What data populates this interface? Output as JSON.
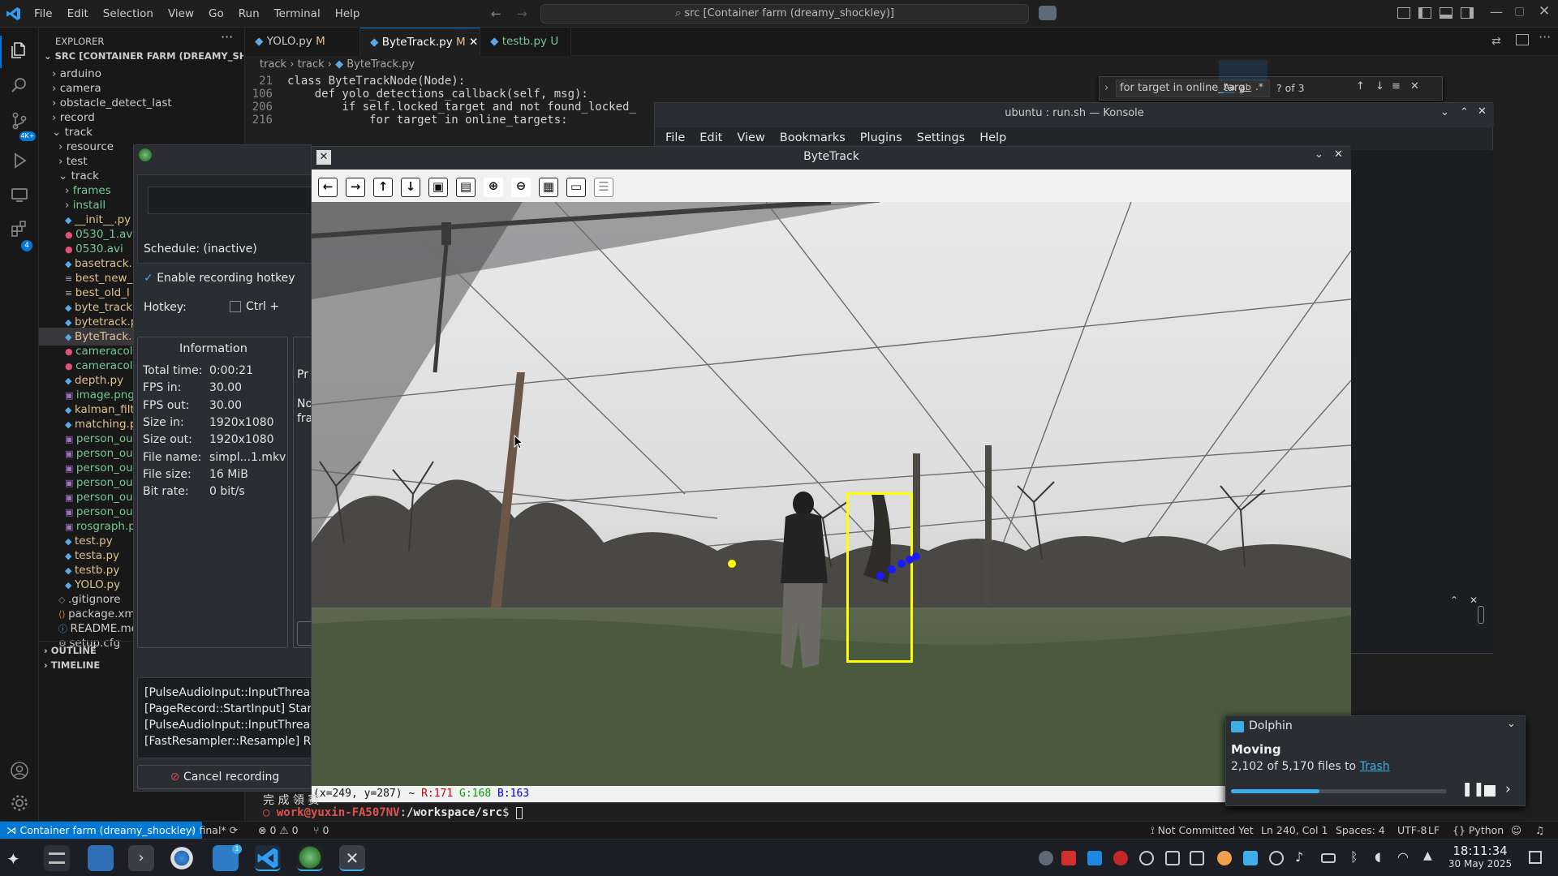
{
  "menubar": [
    "File",
    "Edit",
    "Selection",
    "View",
    "Go",
    "Run",
    "Terminal",
    "Help"
  ],
  "command_center": "src [Container farm (dreamy_shockley)]",
  "explorer": {
    "title": "EXPLORER",
    "root": "SRC [CONTAINER FARM (DREAMY_SHOCK...",
    "items": [
      {
        "label": "arduino",
        "kind": "folder",
        "depth": 1,
        "open": false
      },
      {
        "label": "camera",
        "kind": "folder",
        "depth": 1,
        "open": false
      },
      {
        "label": "obstacle_detect_last",
        "kind": "folder",
        "depth": 1,
        "open": false
      },
      {
        "label": "record",
        "kind": "folder",
        "depth": 1,
        "open": false
      },
      {
        "label": "track",
        "kind": "folder",
        "depth": 1,
        "open": true
      },
      {
        "label": "resource",
        "kind": "folder",
        "depth": 2,
        "open": false
      },
      {
        "label": "test",
        "kind": "folder",
        "depth": 2,
        "open": false
      },
      {
        "label": "track",
        "kind": "folder",
        "depth": 2,
        "open": true
      },
      {
        "label": "frames",
        "kind": "folder",
        "depth": 3,
        "open": false
      },
      {
        "label": "install",
        "kind": "folder",
        "depth": 3,
        "open": false
      },
      {
        "label": "__init__.py",
        "kind": "py",
        "depth": 3
      },
      {
        "label": "0530_1.avi",
        "kind": "avi",
        "depth": 3
      },
      {
        "label": "0530.avi",
        "kind": "avi",
        "depth": 3
      },
      {
        "label": "basetrack.",
        "kind": "py",
        "depth": 3
      },
      {
        "label": "best_new_",
        "kind": "txt",
        "depth": 3
      },
      {
        "label": "best_old_l",
        "kind": "txt",
        "depth": 3
      },
      {
        "label": "byte_track",
        "kind": "py",
        "depth": 3
      },
      {
        "label": "bytetrack.p",
        "kind": "py",
        "depth": 3
      },
      {
        "label": "ByteTrack.",
        "kind": "py",
        "depth": 3,
        "selected": true
      },
      {
        "label": "cameracol",
        "kind": "avi",
        "depth": 3
      },
      {
        "label": "cameracol",
        "kind": "avi",
        "depth": 3
      },
      {
        "label": "depth.py",
        "kind": "py",
        "depth": 3
      },
      {
        "label": "image.png",
        "kind": "png",
        "depth": 3
      },
      {
        "label": "kalman_filt",
        "kind": "py",
        "depth": 3
      },
      {
        "label": "matching.p",
        "kind": "py",
        "depth": 3
      },
      {
        "label": "person_ou",
        "kind": "img",
        "depth": 3
      },
      {
        "label": "person_ou",
        "kind": "img",
        "depth": 3
      },
      {
        "label": "person_ou",
        "kind": "img",
        "depth": 3
      },
      {
        "label": "person_ou",
        "kind": "img",
        "depth": 3
      },
      {
        "label": "person_ou",
        "kind": "img",
        "depth": 3
      },
      {
        "label": "person_ou",
        "kind": "img",
        "depth": 3
      },
      {
        "label": "rosgraph.p",
        "kind": "img",
        "depth": 3
      },
      {
        "label": "test.py",
        "kind": "py",
        "depth": 3
      },
      {
        "label": "testa.py",
        "kind": "py",
        "depth": 3
      },
      {
        "label": "testb.py",
        "kind": "py",
        "depth": 3
      },
      {
        "label": "YOLO.py",
        "kind": "py",
        "depth": 3
      },
      {
        "label": ".gitignore",
        "kind": "git",
        "depth": 2
      },
      {
        "label": "package.xm",
        "kind": "xml",
        "depth": 2
      },
      {
        "label": "README.mc",
        "kind": "md",
        "depth": 2
      },
      {
        "label": "setup.cfg",
        "kind": "cfg",
        "depth": 2
      }
    ],
    "outline": "OUTLINE",
    "timeline": "TIMELINE"
  },
  "tabs": [
    {
      "label": "YOLO.py",
      "status": "M"
    },
    {
      "label": "ByteTrack.py",
      "status": "M"
    },
    {
      "label": "testb.py",
      "status": "U"
    }
  ],
  "breadcrumb": [
    "track",
    "track",
    "ByteTrack.py"
  ],
  "code": [
    {
      "line": "21",
      "text": "class ByteTrackNode(Node):"
    },
    {
      "line": "106",
      "text": "    def yolo_detections_callback(self, msg):"
    },
    {
      "line": "206",
      "text": "        if self.locked_target and not found_locked_"
    },
    {
      "line": "216",
      "text": "            for target in online_targets:"
    }
  ],
  "find_widget": {
    "query": "for target in online_targ",
    "count": "? of 3",
    "case": "Aa",
    "word": "ab",
    "regex": ".*"
  },
  "konsole": {
    "title": "ubuntu : run.sh — Konsole",
    "menu": [
      "File",
      "Edit",
      "View",
      "Bookmarks",
      "Plugins",
      "Settings",
      "Help"
    ],
    "partial_text": "完 成 領 赛",
    "prompt_user": "work@yuxin-FA507NV",
    "prompt_path": "/workspace/src",
    "prompt_symbol": "$"
  },
  "recorder": {
    "schedule": "Schedule: (inactive)",
    "enable_hotkey": "Enable recording hotkey",
    "hotkey_label": "Hotkey:",
    "hotkey_mod": "Ctrl +",
    "info_title": "Information",
    "info": [
      {
        "k": "Total time:",
        "v": "0:00:21"
      },
      {
        "k": "FPS in:",
        "v": "30.00"
      },
      {
        "k": "FPS out:",
        "v": "30.00"
      },
      {
        "k": "Size in:",
        "v": "1920x1080"
      },
      {
        "k": "Size out:",
        "v": "1920x1080"
      },
      {
        "k": "File name:",
        "v": "simpl...1.mkv"
      },
      {
        "k": "File size:",
        "v": "16 MiB"
      },
      {
        "k": "Bit rate:",
        "v": "0 bit/s"
      }
    ],
    "side_text_1": "Pr",
    "side_text_2": "No",
    "side_text_3": "fra",
    "log": [
      "[PulseAudioInput::InputThread",
      "[PageRecord::StartInput] Starte",
      "[PulseAudioInput::InputThread",
      "[FastResampler::Resample] Res"
    ],
    "cancel": "Cancel recording"
  },
  "bytetrack_window": {
    "title": "ByteTrack",
    "toolbar_icons": [
      "arrow-left-icon",
      "arrow-right-icon",
      "arrow-up-icon",
      "arrow-down-icon",
      "image-icon",
      "image-edit-icon",
      "zoom-in-icon",
      "zoom-out-icon",
      "save-icon",
      "clipboard-icon",
      "properties-icon"
    ],
    "status_coords": "(x=249, y=287) ~",
    "status_r": "R:171",
    "status_g": "G:168",
    "status_b": "B:163"
  },
  "dolphin": {
    "app": "Dolphin",
    "heading": "Moving",
    "text": "2,102 of 5,170 files to",
    "link": "Trash",
    "progress": 0.41
  },
  "statusbar": {
    "remote": "Container farm (dreamy_shockley)",
    "branch": "final*",
    "errors": "0",
    "warnings": "0",
    "ports": "0",
    "commit": "Not Committed Yet",
    "position": "Ln 240, Col 1",
    "spaces": "Spaces: 4",
    "encoding": "UTF-8",
    "eol": "LF",
    "language": "Python"
  },
  "clock": {
    "time": "18:11:34",
    "date": "30 May 2025"
  },
  "colors": {
    "accent": "#0078d4",
    "git_modified": "#e2c08d",
    "git_untracked": "#73c991",
    "box": "#ffff00",
    "track_dots": "#1a1aff"
  }
}
